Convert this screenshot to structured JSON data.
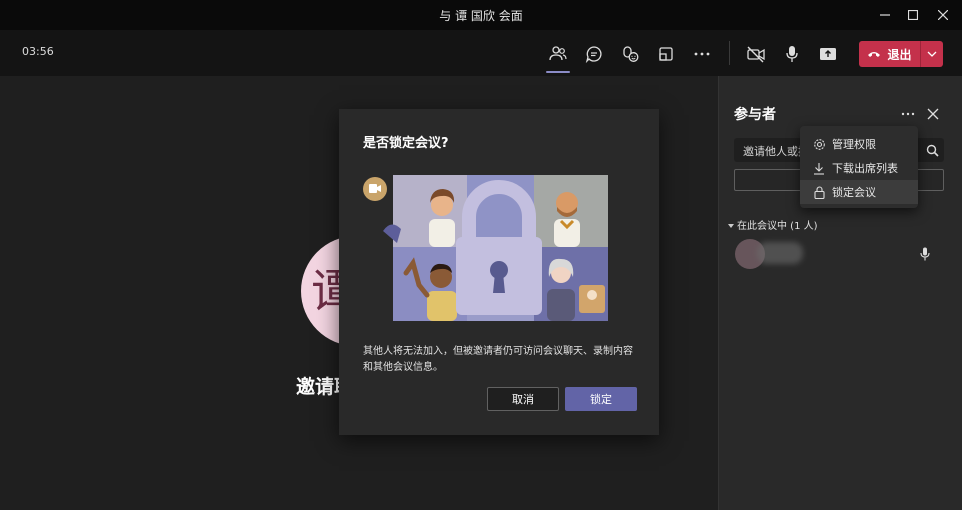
{
  "window": {
    "title": "与 谭 国欣 会面"
  },
  "toolbar": {
    "timer": "03:56",
    "icons": [
      "participants-icon",
      "chat-icon",
      "reactions-icon",
      "rooms-icon",
      "more-icon",
      "camera-off-icon",
      "mic-icon",
      "share-icon"
    ],
    "leave_label": "退出"
  },
  "stage": {
    "avatar_initial": "谭",
    "name": "邀请耶"
  },
  "panel": {
    "title": "参与者",
    "invite_text": "邀请他人或拨号",
    "section_label": "在此会议中 (1 人)"
  },
  "menu": {
    "items": [
      "管理权限",
      "下载出席列表",
      "锁定会议"
    ]
  },
  "dialog": {
    "title": "是否锁定会议?",
    "body": "其他人将无法加入，但被邀请者仍可访问会议聊天、录制内容和其他会议信息。",
    "cancel": "取消",
    "confirm": "锁定"
  },
  "colors": {
    "accent": "#6264a7",
    "leave": "#c4314b",
    "bg": "#1f1f1f",
    "panel": "#292929"
  }
}
